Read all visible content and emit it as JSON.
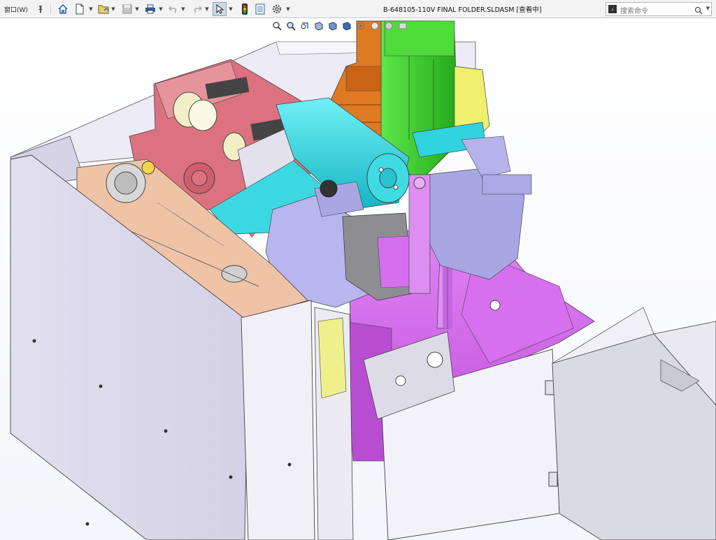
{
  "menu": {
    "window_label": "窗口(W)"
  },
  "title": "B-648105-110V FINAL FOLDER.SLDASM [查看中]",
  "search": {
    "placeholder": "搜索命令"
  },
  "toolbar_icons": [
    "pin-icon",
    "home-icon",
    "new-document-icon",
    "open-folder-icon",
    "save-icon",
    "print-icon",
    "undo-icon",
    "redo-icon",
    "select-arrow-icon",
    "traffic-light-icon",
    "file-properties-icon",
    "gear-icon"
  ],
  "heads_up_icons": [
    "zoom-to-fit-icon",
    "zoom-to-area-icon",
    "previous-view-icon",
    "section-view-icon",
    "view-orientation-icon",
    "display-style-icon",
    "hide-show-icon",
    "edit-appearance-icon",
    "apply-scene-icon",
    "view-settings-icon"
  ],
  "colors": {
    "toolbar_bg": "#f3f3f3",
    "frame_panel": "#e6e3f1",
    "base_magenta": "#d96cf0",
    "red_gearbox": "#d9707e",
    "cyan_cylinder": "#2fd4df",
    "green_motor": "#3dd627",
    "orange_bracket": "#e07a22",
    "yellow_part": "#eef06e",
    "purple_bracket": "#c48ee6",
    "gray_part": "#8e8e92",
    "peach_plate": "#efc3a6"
  }
}
